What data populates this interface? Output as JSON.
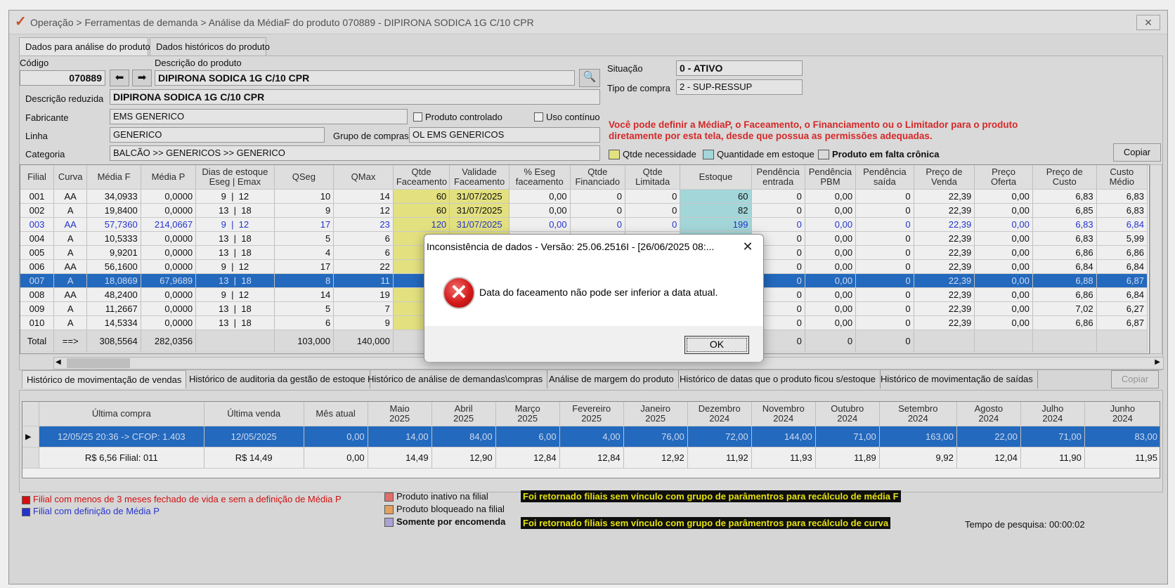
{
  "window": {
    "title": "Operação > Ferramentas de demanda > Análise da MédiaF do produto 070889 - DIPIRONA SODICA 1G C/10 CPR",
    "close_label": "✕"
  },
  "top_tabs": [
    {
      "label": "Dados para análise do produto"
    },
    {
      "label": "Dados históricos do produto"
    }
  ],
  "form": {
    "codigo_label": "Código",
    "codigo_value": "070889",
    "descricao_label": "Descrição do produto",
    "descricao_value": "DIPIRONA SODICA 1G C/10 CPR",
    "situacao_label": "Situação",
    "situacao_value": "0 - ATIVO",
    "tipo_compra_label": "Tipo de compra",
    "tipo_compra_value": "2 - SUP-RESSUP",
    "desc_reduzida_label": "Descrição reduzida",
    "desc_reduzida_value": "DIPIRONA SODICA 1G C/10 CPR",
    "fabricante_label": "Fabricante",
    "fabricante_value": "EMS GENERICO",
    "produto_controlado_label": "Produto controlado",
    "uso_continuo_label": "Uso contínuo",
    "linha_label": "Linha",
    "linha_value": "GENERICO",
    "grupo_compras_label": "Grupo de compras",
    "grupo_compras_value": "OL EMS GENERICOS",
    "categoria_label": "Categoria",
    "categoria_value": "BALCÃO >> GENERICOS >> GENERICO",
    "warning_line1": "Você pode definir a MédiaP, o Faceamento, o Financiamento ou o Limitador para o produto",
    "warning_line2": "diretamente por esta tela, desde que possua as permissões adequadas.",
    "legend_qtde": "Qtde necessidade",
    "legend_estoque": "Quantidade em estoque",
    "legend_falta": "Produto em falta crônica",
    "copiar_label": "Copiar"
  },
  "colors": {
    "yellow": "#f2ef80",
    "cyan": "#a9e3e6",
    "selection": "#1767c6",
    "warning_red": "#e21d1d",
    "legend_red": "#e00000",
    "legend_blue": "#1a2ad8"
  },
  "main_table": {
    "headers": [
      {
        "l1": "Filial",
        "l2": ""
      },
      {
        "l1": "Curva",
        "l2": ""
      },
      {
        "l1": "Média F",
        "l2": ""
      },
      {
        "l1": "Média P",
        "l2": ""
      },
      {
        "l1": "Dias de estoque",
        "l2": "Eseg | Emax"
      },
      {
        "l1": "QSeg",
        "l2": ""
      },
      {
        "l1": "QMax",
        "l2": ""
      },
      {
        "l1": "Qtde",
        "l2": "Faceamento"
      },
      {
        "l1": "Validade",
        "l2": "Faceamento"
      },
      {
        "l1": "% Eseg",
        "l2": "faceamento"
      },
      {
        "l1": "Qtde",
        "l2": "Financiado"
      },
      {
        "l1": "Qtde",
        "l2": "Limitada"
      },
      {
        "l1": "Estoque",
        "l2": ""
      },
      {
        "l1": "Pendência",
        "l2": "entrada"
      },
      {
        "l1": "Pendência",
        "l2": "PBM"
      },
      {
        "l1": "Pendência",
        "l2": "saída"
      },
      {
        "l1": "Preço de",
        "l2": "Venda"
      },
      {
        "l1": "Preço",
        "l2": "Oferta"
      },
      {
        "l1": "Preço de",
        "l2": "Custo"
      },
      {
        "l1": "Custo",
        "l2": "Médio"
      }
    ],
    "rows": [
      {
        "filial": "001",
        "curva": "AA",
        "mediaf": "34,0933",
        "mediap": "0,0000",
        "eseg": "9",
        "emax": "12",
        "qseg": "10",
        "qmax": "14",
        "qface": "60",
        "valface": "31/07/2025",
        "pesegface": "0,00",
        "qfin": "0",
        "qlim": "0",
        "estoque": "60",
        "pentrada": "0",
        "ppbm": "0,00",
        "psaida": "0",
        "pvenda": "22,39",
        "poferta": "0,00",
        "pcusto": "6,83",
        "cmedio": "6,83",
        "style": ""
      },
      {
        "filial": "002",
        "curva": "A",
        "mediaf": "19,8400",
        "mediap": "0,0000",
        "eseg": "13",
        "emax": "18",
        "qseg": "9",
        "qmax": "12",
        "qface": "60",
        "valface": "31/07/2025",
        "pesegface": "0,00",
        "qfin": "0",
        "qlim": "0",
        "estoque": "82",
        "pentrada": "0",
        "ppbm": "0,00",
        "psaida": "0",
        "pvenda": "22,39",
        "poferta": "0,00",
        "pcusto": "6,85",
        "cmedio": "6,83",
        "style": ""
      },
      {
        "filial": "003",
        "curva": "AA",
        "mediaf": "57,7360",
        "mediap": "214,0667",
        "eseg": "9",
        "emax": "12",
        "qseg": "17",
        "qmax": "23",
        "qface": "120",
        "valface": "31/07/2025",
        "pesegface": "0,00",
        "qfin": "0",
        "qlim": "0",
        "estoque": "199",
        "pentrada": "0",
        "ppbm": "0,00",
        "psaida": "0",
        "pvenda": "22,39",
        "poferta": "0,00",
        "pcusto": "6,83",
        "cmedio": "6,84",
        "style": "blue"
      },
      {
        "filial": "004",
        "curva": "A",
        "mediaf": "10,5333",
        "mediap": "0,0000",
        "eseg": "13",
        "emax": "18",
        "qseg": "5",
        "qmax": "6",
        "qface": "",
        "valface": "",
        "pesegface": "",
        "qfin": "",
        "qlim": "",
        "estoque": "",
        "pentrada": "0",
        "ppbm": "0,00",
        "psaida": "0",
        "pvenda": "22,39",
        "poferta": "0,00",
        "pcusto": "6,83",
        "cmedio": "5,99",
        "style": ""
      },
      {
        "filial": "005",
        "curva": "A",
        "mediaf": "9,9201",
        "mediap": "0,0000",
        "eseg": "13",
        "emax": "18",
        "qseg": "4",
        "qmax": "6",
        "qface": "",
        "valface": "",
        "pesegface": "",
        "qfin": "",
        "qlim": "",
        "estoque": "",
        "pentrada": "0",
        "ppbm": "0,00",
        "psaida": "0",
        "pvenda": "22,39",
        "poferta": "0,00",
        "pcusto": "6,86",
        "cmedio": "6,86",
        "style": ""
      },
      {
        "filial": "006",
        "curva": "AA",
        "mediaf": "56,1600",
        "mediap": "0,0000",
        "eseg": "9",
        "emax": "12",
        "qseg": "17",
        "qmax": "22",
        "qface": "",
        "valface": "",
        "pesegface": "",
        "qfin": "",
        "qlim": "",
        "estoque": "",
        "pentrada": "0",
        "ppbm": "0,00",
        "psaida": "0",
        "pvenda": "22,39",
        "poferta": "0,00",
        "pcusto": "6,84",
        "cmedio": "6,84",
        "style": ""
      },
      {
        "filial": "007",
        "curva": "A",
        "mediaf": "18,0869",
        "mediap": "67,9689",
        "eseg": "13",
        "emax": "18",
        "qseg": "8",
        "qmax": "11",
        "qface": "",
        "valface": "",
        "pesegface": "",
        "qfin": "",
        "qlim": "",
        "estoque": "",
        "pentrada": "0",
        "ppbm": "0,00",
        "psaida": "0",
        "pvenda": "22,39",
        "poferta": "0,00",
        "pcusto": "6,88",
        "cmedio": "6,87",
        "style": "sel"
      },
      {
        "filial": "008",
        "curva": "AA",
        "mediaf": "48,2400",
        "mediap": "0,0000",
        "eseg": "9",
        "emax": "12",
        "qseg": "14",
        "qmax": "19",
        "qface": "",
        "valface": "",
        "pesegface": "",
        "qfin": "",
        "qlim": "",
        "estoque": "",
        "pentrada": "0",
        "ppbm": "0,00",
        "psaida": "0",
        "pvenda": "22,39",
        "poferta": "0,00",
        "pcusto": "6,86",
        "cmedio": "6,84",
        "style": ""
      },
      {
        "filial": "009",
        "curva": "A",
        "mediaf": "11,2667",
        "mediap": "0,0000",
        "eseg": "13",
        "emax": "18",
        "qseg": "5",
        "qmax": "7",
        "qface": "",
        "valface": "",
        "pesegface": "",
        "qfin": "",
        "qlim": "",
        "estoque": "",
        "pentrada": "0",
        "ppbm": "0,00",
        "psaida": "0",
        "pvenda": "22,39",
        "poferta": "0,00",
        "pcusto": "7,02",
        "cmedio": "6,27",
        "style": ""
      },
      {
        "filial": "010",
        "curva": "A",
        "mediaf": "14,5334",
        "mediap": "0,0000",
        "eseg": "13",
        "emax": "18",
        "qseg": "6",
        "qmax": "9",
        "qface": "",
        "valface": "",
        "pesegface": "",
        "qfin": "",
        "qlim": "",
        "estoque": "",
        "pentrada": "0",
        "ppbm": "0,00",
        "psaida": "0",
        "pvenda": "22,39",
        "poferta": "0,00",
        "pcusto": "6,86",
        "cmedio": "6,87",
        "style": ""
      }
    ],
    "total": {
      "label": "Total",
      "curva": "==>",
      "mediaf": "308,5564",
      "mediap": "282,0356",
      "qseg": "103,000",
      "qmax": "140,000",
      "pentrada": "0",
      "ppbm": "0",
      "psaida": "0"
    }
  },
  "bottom_tabs": [
    {
      "label": "Histórico de movimentação de vendas"
    },
    {
      "label": "Histórico de auditoria da gestão de estoque"
    },
    {
      "label": "Histórico de análise de demandas\\compras"
    },
    {
      "label": "Análise de margem do produto"
    },
    {
      "label": "Histórico de datas que o produto ficou s/estoque"
    },
    {
      "label": "Histórico de movimentação de saídas"
    }
  ],
  "bottom_copiar": "Copiar",
  "history_table": {
    "headers": [
      {
        "l1": "Última compra",
        "l2": ""
      },
      {
        "l1": "Última venda",
        "l2": ""
      },
      {
        "l1": "Mês atual",
        "l2": ""
      },
      {
        "l1": "Maio",
        "l2": "2025"
      },
      {
        "l1": "Abril",
        "l2": "2025"
      },
      {
        "l1": "Março",
        "l2": "2025"
      },
      {
        "l1": "Fevereiro",
        "l2": "2025"
      },
      {
        "l1": "Janeiro",
        "l2": "2025"
      },
      {
        "l1": "Dezembro",
        "l2": "2024"
      },
      {
        "l1": "Novembro",
        "l2": "2024"
      },
      {
        "l1": "Outubro",
        "l2": "2024"
      },
      {
        "l1": "Setembro",
        "l2": "2024"
      },
      {
        "l1": "Agosto",
        "l2": "2024"
      },
      {
        "l1": "Julho",
        "l2": "2024"
      },
      {
        "l1": "Junho",
        "l2": "2024"
      }
    ],
    "rows": [
      {
        "cells": [
          "12/05/25 20:36 -> CFOP: 1.403",
          "12/05/2025",
          "0,00",
          "14,00",
          "84,00",
          "6,00",
          "4,00",
          "76,00",
          "72,00",
          "144,00",
          "71,00",
          "163,00",
          "22,00",
          "71,00",
          "83,00"
        ],
        "selected": true
      },
      {
        "cells": [
          "R$ 6,56 Filial: 011",
          "R$ 14,49",
          "0,00",
          "14,49",
          "12,90",
          "12,84",
          "12,84",
          "12,92",
          "11,92",
          "11,93",
          "11,89",
          "9,92",
          "12,04",
          "11,90",
          "11,95"
        ],
        "selected": false
      }
    ]
  },
  "legends": {
    "red_text": "Filial com menos de 3 meses fechado de vida e sem a definição de Média P",
    "blue_text": "Filial com definição de Média P",
    "inativo": "Produto inativo na filial",
    "bloqueado": "Produto bloqueado na filial",
    "encomenda": "Somente por encomenda",
    "bar1": "Foi retornado filiais sem vínculo com grupo de parâmentros para recálculo de média F",
    "bar2": "Foi retornado filiais sem vínculo com grupo de parâmentros para recálculo de curva",
    "tempo": "Tempo de pesquisa: 00:00:02"
  },
  "dialog": {
    "title": "Inconsistência de dados - Versão: 25.06.2516I - [26/06/2025 08:...",
    "close": "✕",
    "message": "Data do faceamento não pode ser inferior a data atual.",
    "ok": "OK",
    "icon": "error-icon"
  }
}
